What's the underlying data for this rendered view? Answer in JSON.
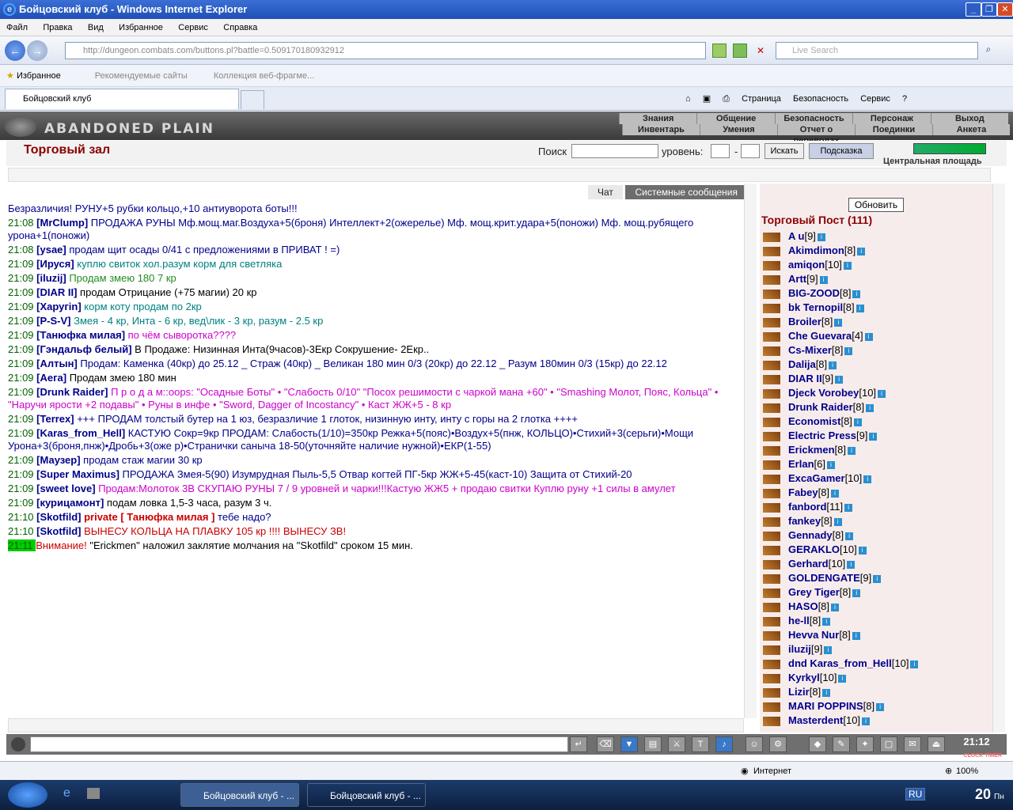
{
  "window": {
    "title": "Бойцовский клуб - Windows Internet Explorer"
  },
  "menu": [
    "Файл",
    "Правка",
    "Вид",
    "Избранное",
    "Сервис",
    "Справка"
  ],
  "address": {
    "url": "http://dungeon.combats.com/buttons.pl?battle=0.509170180932912",
    "search_placeholder": "Live Search"
  },
  "favorites": {
    "label": "Избранное",
    "items": [
      "Рекомендуемые сайты",
      "Коллекция веб-фрагме..."
    ]
  },
  "tabs": [
    {
      "label": "Бойцовский клуб"
    }
  ],
  "commands": [
    "Страница",
    "Безопасность",
    "Сервис"
  ],
  "game": {
    "logo": "ABANDONED PLAIN",
    "menu_top": [
      "Знания",
      "Общение",
      "Безопасность",
      "Персонаж",
      "Выход"
    ],
    "menu_bottom": [
      "Инвентарь",
      "Умения",
      "Отчет о переводах",
      "Поединки",
      "Анкета"
    ]
  },
  "hall": {
    "title": "Торговый зал",
    "search_label": "Поиск",
    "level_label": "уровень:",
    "dash": "-",
    "search_button": "Искать",
    "hint_button": "Подсказка",
    "location": "Центральная площадь"
  },
  "chat": {
    "tab_chat": "Чат",
    "tab_system": "Системные сообщения",
    "messages": [
      {
        "time": "",
        "nick": "",
        "text": "Безразличия! РУНУ+5 рубки кольцо,+10 антиуворота боты!!!",
        "color": "#00008b"
      },
      {
        "time": "21:08",
        "nick": "MrClump",
        "text": "ПРОДАЖА  РУНЫ Мф.мощ.маг.Воздуха+5(броня) Интеллект+2(ожерелье) Мф. мощ.крит.удара+5(поножи) Мф. мощ.рубящего урона+1(поножи)",
        "color": "#00008b"
      },
      {
        "time": "21:08",
        "nick": "ysae",
        "text": "продам щит осады 0/41 с предложениями в ПРИВАТ ! =)",
        "color": "#00008b"
      },
      {
        "time": "21:09",
        "nick": "Ируся",
        "text": "куплю свиток хол.разум корм для светляка",
        "color": "#008080"
      },
      {
        "time": "21:09",
        "nick": "iluzij",
        "text": "Продам змею 180 7 кр",
        "color": "#228b22"
      },
      {
        "time": "21:09",
        "nick": "DIAR II",
        "text": "продам Отрицание (+75 магии) 20 кр",
        "color": "#000000"
      },
      {
        "time": "21:09",
        "nick": "Харугin",
        "text": "корм коту продам по 2кр",
        "color": "#008080"
      },
      {
        "time": "21:09",
        "nick": "P-S-V",
        "text": "Змея - 4 кр, Инта - 6 кр, вед\\лик - 3 кр, разум - 2.5 кр",
        "color": "#008080"
      },
      {
        "time": "21:09",
        "nick": "Танюфка милая",
        "text": "по чём сыворотка????",
        "color": "#cc00cc"
      },
      {
        "time": "21:09",
        "nick": "Гэндальф белый",
        "text": "В Продаже: Низинная Инта(9часов)-3Екр Сокрушение- 2Екр..",
        "color": "#000000"
      },
      {
        "time": "21:09",
        "nick": "Алтын",
        "text": "Продам: Каменка (40кр) до 25.12 _ Страж (40кр) _ Великан 180 мин 0/3 (20кр) до 22.12 _ Разум 180мин 0/3 (15кр) до 22.12",
        "color": "#00008b"
      },
      {
        "time": "21:09",
        "nick": "Aега",
        "text": "Продам змею 180 мин",
        "color": "#000000"
      },
      {
        "time": "21:09",
        "nick": "Drunk Raider",
        "text": "П р о д а м::oops: \"Осадные Боты\" • \"Слабость 0/10\" \"Посох решимости с чаркой мана +60\" • \"Smashing Молот, Пояс, Кольца\" • \"Наручи ярости +2 подавы\" • Руны в инфе • \"Sword, Dagger of Incostancy\" • Каст ЖЖ+5 - 8 кр",
        "color": "#cc00cc"
      },
      {
        "time": "21:09",
        "nick": "Terrex",
        "text": "+++ ПРОДАМ толстый бутер на 1 юз, безразличие 1 глоток, низинную инту, инту с горы на 2 глотка ++++",
        "color": "#00008b"
      },
      {
        "time": "21:09",
        "nick": "Karas_from_Hell",
        "text": "КАСТУЮ Сокр=9кр ПРОДАМ: Слабость(1/10)=350кр Режка+5(пояс)•Воздух+5(пнж, КОЛЬЦО)•Стихий+3(серьги)•Мощи Урона+3(броня,пнж)•Дробь+3(оже р)•Странички саныча 18-50(уточняйте наличие нужной)•ЕКР(1-55)",
        "color": "#00008b"
      },
      {
        "time": "21:09",
        "nick": "Маузер",
        "text": "продам стаж магии 30 кр",
        "color": "#00008b"
      },
      {
        "time": "21:09",
        "nick": "Super Maximus",
        "text": "ПРОДАЖА  Змея-5(90) Изумрудная Пыль-5,5 Отвар когтей ПГ-5кр  ЖЖ+5-45(каст-10) Защита от Стихий-20",
        "color": "#00008b"
      },
      {
        "time": "21:09",
        "nick": "sweet love",
        "text": "Продам:Молоток 3В  СКУПАЮ РУНЫ 7 / 9 уровней и чарки!!!Кастую ЖЖ5 + продаю свитки  Куплю руну +1 силы в амулет",
        "color": "#cc00cc"
      },
      {
        "time": "21:09",
        "nick": "курицамонт",
        "text": "подам ловка 1,5-3 часа, разум 3 ч.",
        "color": "#000000"
      },
      {
        "time": "21:10",
        "nick": "Skotfild",
        "text": "тебе надо?",
        "private": "private [ Танюфка милая ]",
        "color": "#00008b"
      },
      {
        "time": "21:10",
        "nick": "Skotfild",
        "text": "ВЫНЕСУ КОЛЬЦА НА ПЛАВКУ 105 кр !!!! ВЫНЕСУ ЗВ!",
        "color": "#cc0000"
      },
      {
        "time": "21:11",
        "nick": "",
        "text": "\"Erickmen\" наложил заклятие молчания на \"Skotfild\" сроком 15 мин.",
        "warn": "Внимание!",
        "color": "#000000"
      }
    ]
  },
  "post": {
    "refresh": "Обновить",
    "title": "Торговый Пост (111)",
    "users": [
      {
        "name": "A u",
        "level": "[9]"
      },
      {
        "name": "Akimdimon",
        "level": "[8]"
      },
      {
        "name": "amiqon",
        "level": "[10]"
      },
      {
        "name": "Artt",
        "level": "[9]"
      },
      {
        "name": "BIG-ZOOD",
        "level": "[8]"
      },
      {
        "name": "bk Ternopil",
        "level": "[8]"
      },
      {
        "name": "Broiler",
        "level": "[8]"
      },
      {
        "name": "Che Guevara",
        "level": "[4]"
      },
      {
        "name": "Cs-Mixer",
        "level": "[8]"
      },
      {
        "name": "Dalija",
        "level": "[8]"
      },
      {
        "name": "DIAR II",
        "level": "[9]"
      },
      {
        "name": "Djeck Vorobey",
        "level": "[10]"
      },
      {
        "name": "Drunk Raider",
        "level": "[8]"
      },
      {
        "name": "Economist",
        "level": "[8]"
      },
      {
        "name": "Electric Press",
        "level": "[9]"
      },
      {
        "name": "Erickmen",
        "level": "[8]"
      },
      {
        "name": "Erlan",
        "level": "[6]"
      },
      {
        "name": "ExcaGamer",
        "level": "[10]"
      },
      {
        "name": "Fabey",
        "level": "[8]"
      },
      {
        "name": "fanbord",
        "level": "[11]"
      },
      {
        "name": "fankey",
        "level": "[8]"
      },
      {
        "name": "Gennady",
        "level": "[8]"
      },
      {
        "name": "GERAKLO",
        "level": "[10]"
      },
      {
        "name": "Gerhard",
        "level": "[10]"
      },
      {
        "name": "GOLDENGATE",
        "level": "[9]"
      },
      {
        "name": "Grey Tiger",
        "level": "[8]"
      },
      {
        "name": "HASO",
        "level": "[8]"
      },
      {
        "name": "he-ll",
        "level": "[8]"
      },
      {
        "name": "Hevva Nur",
        "level": "[8]"
      },
      {
        "name": "iluzij",
        "level": "[9]"
      },
      {
        "name": "dnd Karas_from_Hell",
        "level": "[10]"
      },
      {
        "name": "Kyrkyl",
        "level": "[10]"
      },
      {
        "name": "Lizir",
        "level": "[8]"
      },
      {
        "name": "MARI POPPINS",
        "level": "[8]"
      },
      {
        "name": "Masterdent",
        "level": "[10]"
      }
    ]
  },
  "clock": "21:12",
  "clock_label": "CLOCK TIMER",
  "status": {
    "zone": "Интернет",
    "zoom": "100%"
  },
  "taskbar": {
    "tasks": [
      "Бойцовский клуб - ...",
      "Бойцовский клуб - ..."
    ],
    "lang": "RU",
    "time": "20",
    "day": "Пн"
  }
}
